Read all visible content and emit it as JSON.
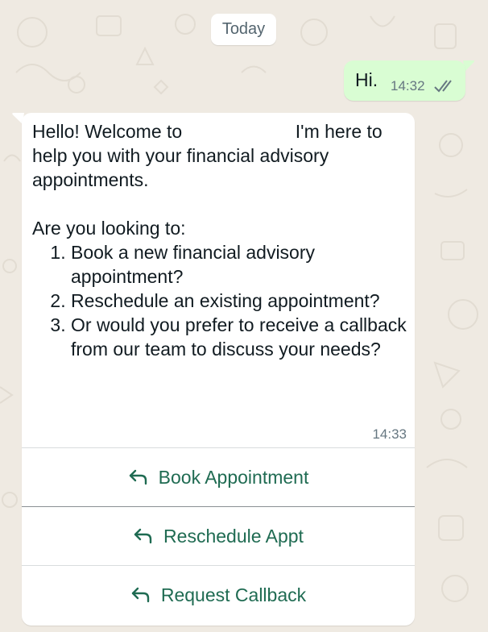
{
  "chat": {
    "date_label": "Today",
    "outgoing": {
      "text": "Hi.",
      "time": "14:32",
      "status_icon": "double-check-read-icon"
    },
    "incoming": {
      "greeting": "Hello! Welcome to                      I'm here to help you with your financial advisory appointments.",
      "prompt": "Are you looking to:",
      "options": [
        "Book a new financial advisory appointment?",
        "Reschedule an existing appointment?",
        "Or would you prefer to receive a callback from our team to discuss your needs?"
      ],
      "time": "14:33",
      "quick_replies": [
        {
          "label": "Book Appointment",
          "icon": "reply-arrow-icon"
        },
        {
          "label": "Reschedule Appt",
          "icon": "reply-arrow-icon"
        },
        {
          "label": "Request Callback",
          "icon": "reply-arrow-icon"
        }
      ]
    }
  },
  "colors": {
    "wallpaper": "#efeae2",
    "outgoing_bubble": "#d9fdd3",
    "incoming_bubble": "#ffffff",
    "action_text": "#1f6b52",
    "read_ticks": "#667781"
  }
}
